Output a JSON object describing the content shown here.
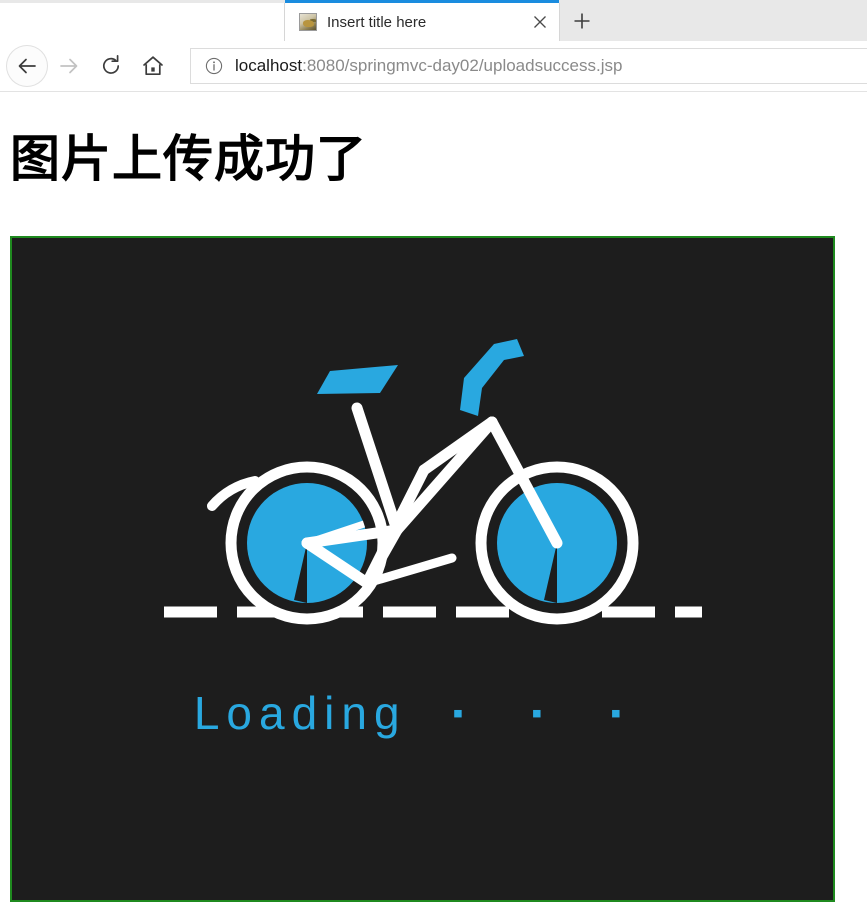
{
  "browser": {
    "accent_color": "#1a8cdf",
    "tab": {
      "title": "Insert title here",
      "favicon_name": "page-favicon",
      "close_label": "✕"
    },
    "newtab_label": "＋",
    "nav": {
      "back_label": "←",
      "forward_label": "→",
      "reload_label": "⟳",
      "home_label": "⌂"
    },
    "url": {
      "host": "localhost",
      "rest": ":8080/springmvc-day02/uploadsuccess.jsp",
      "info_icon": "info-circle-icon"
    }
  },
  "page": {
    "heading": "图片上传成功了",
    "image": {
      "border_color": "#1f8a1f",
      "background_color": "#1d1d1d",
      "accent_color": "#29a8e0",
      "line_color": "#ffffff",
      "alt_name": "bicycle-loading-graphic",
      "loading_text": "Loading",
      "loading_dots": "▪ ▪ ▪"
    }
  }
}
